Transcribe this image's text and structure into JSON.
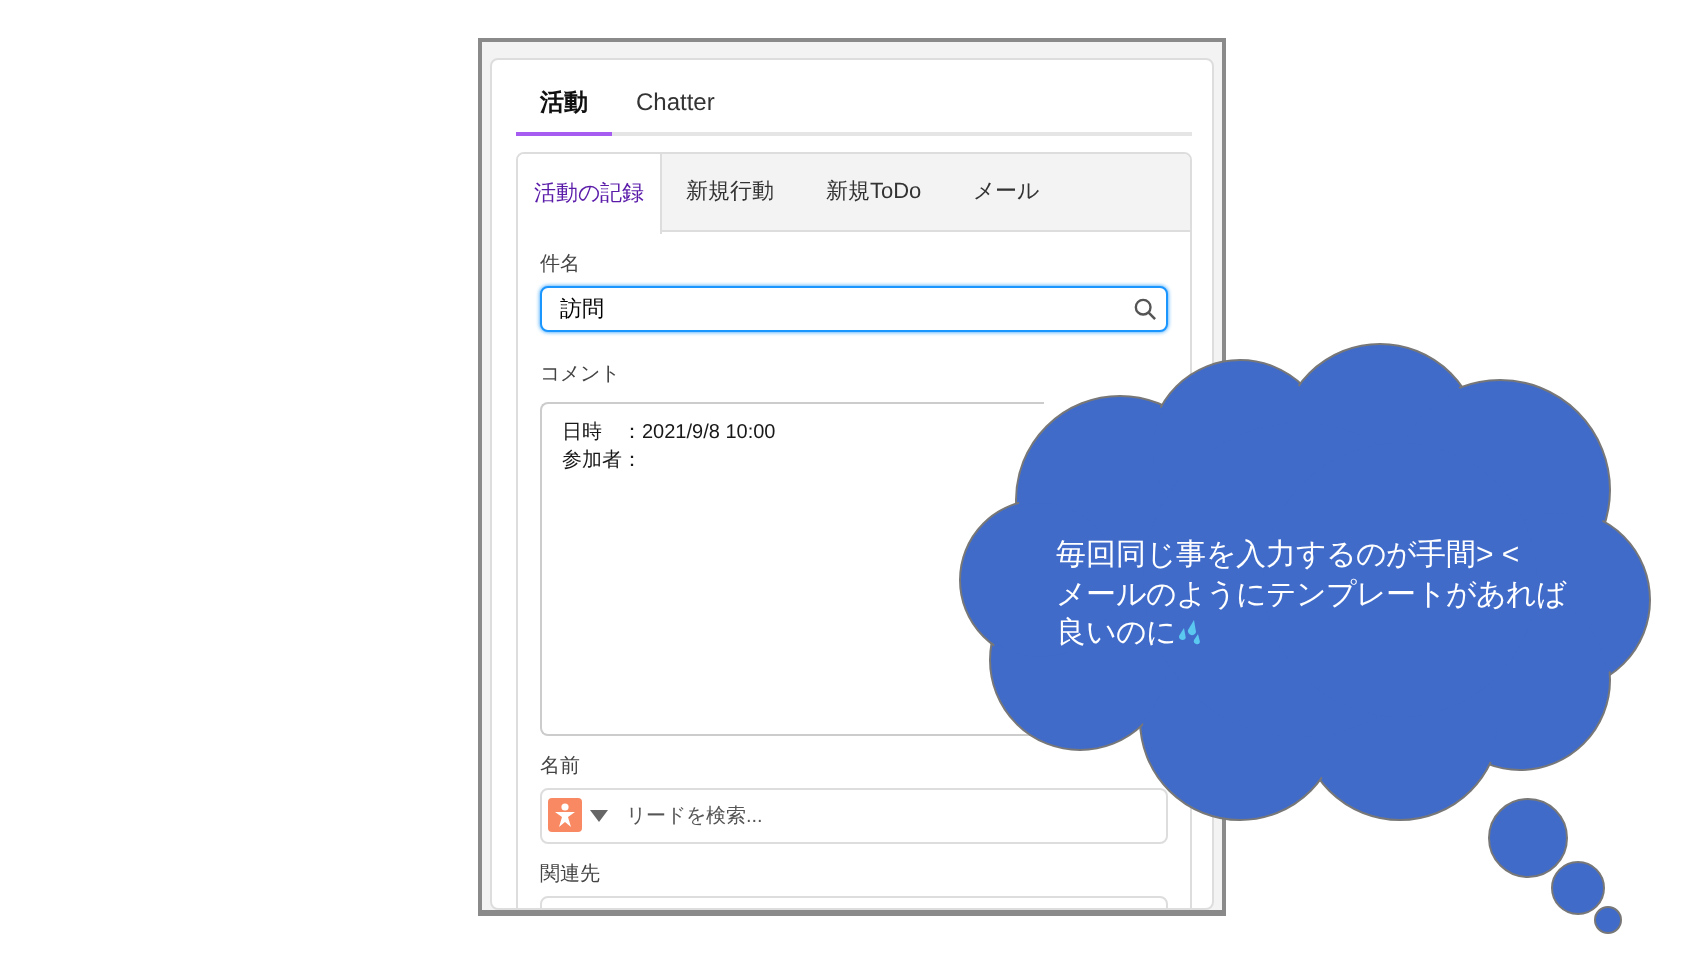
{
  "tabs": [
    {
      "label": "活動",
      "selected": true
    },
    {
      "label": "Chatter",
      "selected": false
    }
  ],
  "sub_tabs": [
    {
      "label": "活動の記録",
      "selected": true
    },
    {
      "label": "新規行動",
      "selected": false
    },
    {
      "label": "新規ToDo",
      "selected": false
    },
    {
      "label": "メール",
      "selected": false
    }
  ],
  "subject": {
    "label": "件名",
    "value": "訪問"
  },
  "comment": {
    "label": "コメント",
    "value": "日時　：2021/9/8 10:00\n参加者："
  },
  "name": {
    "label": "名前",
    "placeholder": "リードを検索..."
  },
  "related": {
    "label": "関連先"
  },
  "thought_cloud": {
    "lines": [
      "毎回同じ事を入力するのが手間> <",
      "メールのようにテンプレートがあれば",
      "良いのに"
    ]
  }
}
